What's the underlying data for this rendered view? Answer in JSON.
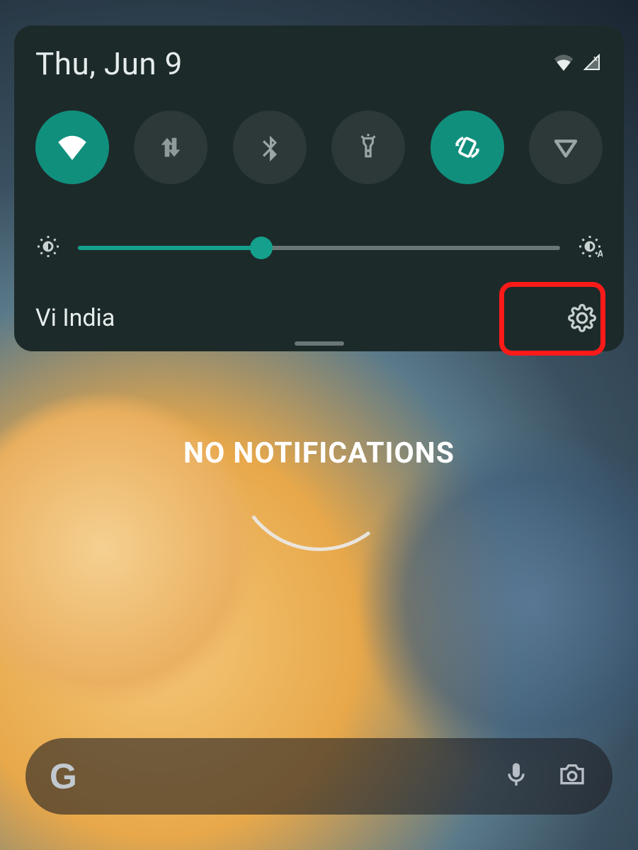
{
  "date": "Thu, Jun 9",
  "carrier": "Vi India",
  "no_notifications": "NO NOTIFICATIONS",
  "brightness_percent": 38,
  "tiles": {
    "wifi": {
      "name": "wifi",
      "active": true
    },
    "data": {
      "name": "mobile-data",
      "active": false
    },
    "bluetooth": {
      "name": "bluetooth",
      "active": false
    },
    "flashlight": {
      "name": "flashlight",
      "active": false
    },
    "rotate": {
      "name": "auto-rotate",
      "active": true
    },
    "dnd": {
      "name": "dnd",
      "active": false
    }
  },
  "status_icons": [
    "wifi-signal",
    "cell-no-signal-x"
  ],
  "google_bar": {
    "logo": "G"
  }
}
